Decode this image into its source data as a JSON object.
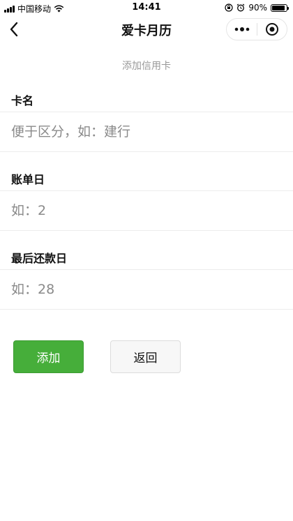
{
  "status_bar": {
    "carrier": "中国移动",
    "time": "14:41",
    "battery": "90%",
    "battery_level": 0.9,
    "icons": [
      "signal-icon",
      "wifi-icon",
      "orientation-lock-icon",
      "alarm-icon",
      "battery-icon"
    ]
  },
  "nav": {
    "title": "爱卡月历",
    "back_icon": "chevron-left-icon",
    "more_icon": "more-dots-icon",
    "close_icon": "target-close-icon"
  },
  "page": {
    "subtitle": "添加信用卡"
  },
  "form": {
    "card_name": {
      "label": "卡名",
      "placeholder": "便于区分，如：建行"
    },
    "bill_day": {
      "label": "账单日",
      "placeholder": "如：2"
    },
    "due_day": {
      "label": "最后还款日",
      "placeholder": "如：28"
    }
  },
  "buttons": {
    "add": "添加",
    "back": "返回"
  },
  "colors": {
    "primary": "#46ae3a",
    "secondary_bg": "#f7f7f7",
    "placeholder": "#8a8a8a",
    "subtitle": "#999999"
  }
}
